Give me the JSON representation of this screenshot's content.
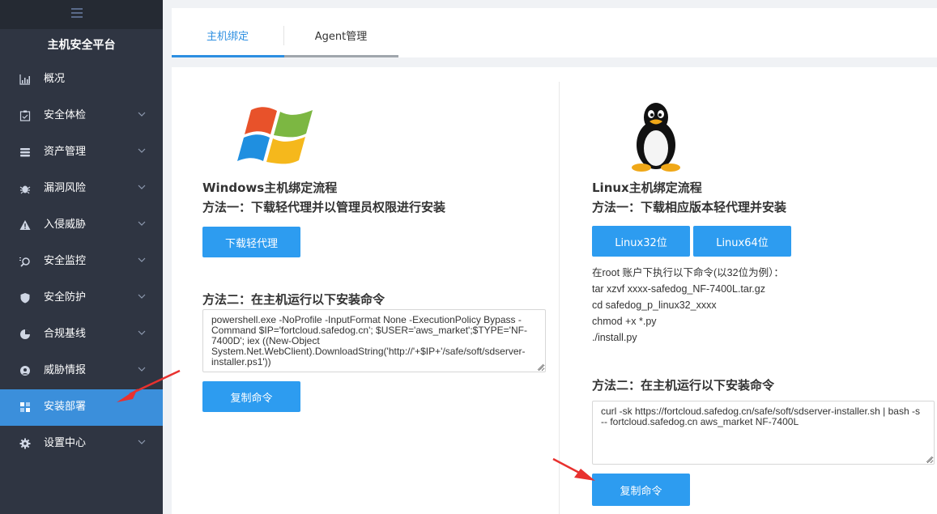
{
  "sidebar": {
    "brand": "主机安全平台",
    "items": [
      {
        "label": "概况",
        "icon": "bar-chart-icon",
        "expandable": false,
        "active": false
      },
      {
        "label": "安全体检",
        "icon": "clipboard-check-icon",
        "expandable": true,
        "active": false
      },
      {
        "label": "资产管理",
        "icon": "stack-icon",
        "expandable": true,
        "active": false
      },
      {
        "label": "漏洞风险",
        "icon": "bug-icon",
        "expandable": true,
        "active": false
      },
      {
        "label": "入侵威胁",
        "icon": "warning-icon",
        "expandable": true,
        "active": false
      },
      {
        "label": "安全监控",
        "icon": "monitor-search-icon",
        "expandable": true,
        "active": false
      },
      {
        "label": "安全防护",
        "icon": "shield-icon",
        "expandable": true,
        "active": false
      },
      {
        "label": "合规基线",
        "icon": "pie-icon",
        "expandable": true,
        "active": false
      },
      {
        "label": "威胁情报",
        "icon": "intel-icon",
        "expandable": true,
        "active": false
      },
      {
        "label": "安装部署",
        "icon": "grid-icon",
        "expandable": false,
        "active": true
      },
      {
        "label": "设置中心",
        "icon": "gear-icon",
        "expandable": true,
        "active": false
      }
    ]
  },
  "tabs": [
    {
      "label": "主机绑定",
      "active": true
    },
    {
      "label": "Agent管理",
      "active": false
    }
  ],
  "windows": {
    "title": "Windows主机绑定流程",
    "method1": "方法一：下载轻代理并以管理员权限进行安装",
    "download_button": "下载轻代理",
    "method2": "方法二：在主机运行以下安装命令",
    "command": "powershell.exe -NoProfile -InputFormat None -ExecutionPolicy Bypass -Command $IP='fortcloud.safedog.cn'; $USER='aws_market';$TYPE='NF-7400D'; iex ((New-Object System.Net.WebClient).DownloadString('http://'+$IP+'/safe/soft/sdserver-installer.ps1'))",
    "copy_button": "复制命令"
  },
  "linux": {
    "title": "Linux主机绑定流程",
    "method1": "方法一：下载相应版本轻代理并安装",
    "btn32": "Linux32位",
    "btn64": "Linux64位",
    "instructions": [
      "在root 账户下执行以下命令(以32位为例）：",
      "tar xzvf xxxx-safedog_NF-7400L.tar.gz",
      "cd safedog_p_linux32_xxxx",
      "chmod +x *.py",
      "./install.py"
    ],
    "method2": "方法二：在主机运行以下安装命令",
    "command": "curl -sk https://fortcloud.safedog.cn/safe/soft/sdserver-installer.sh | bash -s -- fortcloud.safedog.cn aws_market NF-7400L",
    "copy_button": "复制命令"
  },
  "colors": {
    "sidebar_bg": "#2f3542",
    "active_item": "#3b8fdb",
    "accent": "#2d8fe1",
    "button": "#2d9cf0",
    "arrow": "#e8312f"
  }
}
